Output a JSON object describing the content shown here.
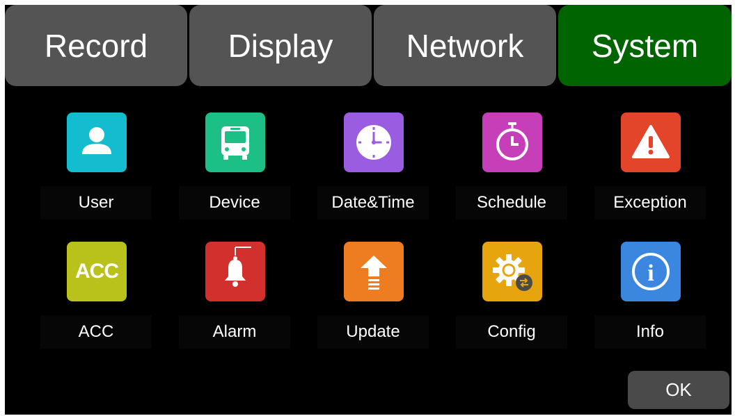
{
  "tabs": [
    {
      "label": "Record"
    },
    {
      "label": "Display"
    },
    {
      "label": "Network"
    },
    {
      "label": "System",
      "active": true
    }
  ],
  "colors": {
    "tab_inactive": "#545454",
    "tab_active": "#006400",
    "background": "#000000",
    "user_tile": "#13bccf",
    "device_tile": "#1cbf86",
    "datetime_tile": "#9a5ce0",
    "schedule_tile": "#c63fb8",
    "exception_tile": "#e2452a",
    "acc_tile": "#b9c21a",
    "alarm_tile": "#d1302c",
    "update_tile": "#ee7d22",
    "config_tile": "#e6a40f",
    "info_tile": "#3b86df"
  },
  "grid": {
    "items": [
      {
        "label": "User",
        "icon": "user-icon"
      },
      {
        "label": "Device",
        "icon": "bus-icon"
      },
      {
        "label": "Date&Time",
        "icon": "clock-icon"
      },
      {
        "label": "Schedule",
        "icon": "stopwatch-icon"
      },
      {
        "label": "Exception",
        "icon": "warning-icon"
      },
      {
        "label": "ACC",
        "icon": "acc-icon",
        "icon_text": "ACC"
      },
      {
        "label": "Alarm",
        "icon": "bell-icon"
      },
      {
        "label": "Update",
        "icon": "upload-arrow-icon"
      },
      {
        "label": "Config",
        "icon": "gear-icon"
      },
      {
        "label": "Info",
        "icon": "info-icon",
        "icon_text": "i"
      }
    ]
  },
  "ok_label": "OK"
}
